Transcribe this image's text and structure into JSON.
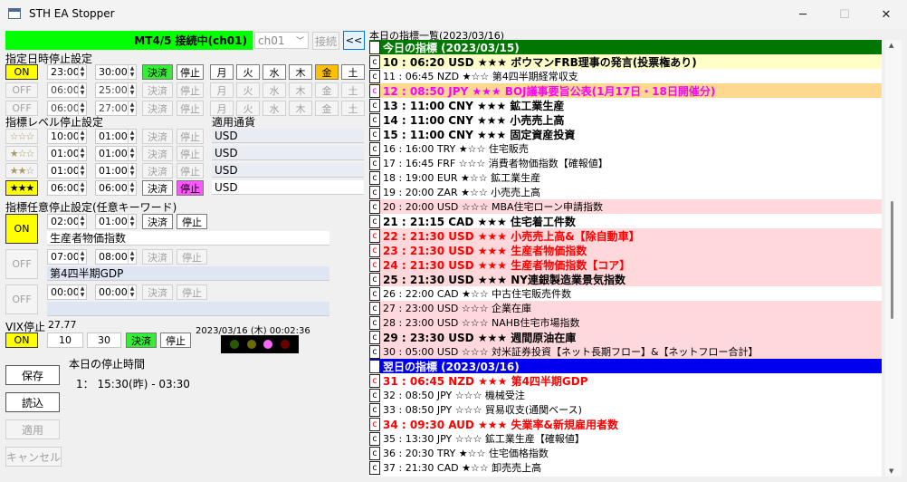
{
  "window": {
    "title": "STH EA Stopper"
  },
  "controls": {
    "minimize": "─",
    "maximize": "☐",
    "close": "✕"
  },
  "status": {
    "label": "MT4/5 接続中(ch01)",
    "channel": "ch01",
    "connect": "接続",
    "collapse": "<<",
    "color": "#00ff00"
  },
  "schedule": {
    "title": "指定日時停止設定",
    "rows": [
      {
        "toggle": "ON",
        "from": "23:00",
        "to": "30:00",
        "settle": "決済",
        "stop": "停止",
        "days": [
          "月",
          "火",
          "水",
          "木",
          "金",
          "土"
        ],
        "on": true
      },
      {
        "toggle": "OFF",
        "from": "06:00",
        "to": "25:00",
        "settle": "決済",
        "stop": "停止",
        "days": [
          "月",
          "火",
          "水",
          "木",
          "金",
          "土"
        ],
        "on": false
      },
      {
        "toggle": "OFF",
        "from": "06:00",
        "to": "27:00",
        "settle": "決済",
        "stop": "停止",
        "days": [
          "月",
          "火",
          "水",
          "木",
          "金",
          "土"
        ],
        "on": false
      }
    ]
  },
  "level": {
    "title": "指標レベル停止設定",
    "currency_title": "適用通貨",
    "rows": [
      {
        "stars": "☆☆☆",
        "from": "10:00",
        "to": "01:00",
        "settle": "決済",
        "stop": "停止",
        "currency": "USD"
      },
      {
        "stars": "★☆☆",
        "from": "01:00",
        "to": "01:00",
        "settle": "決済",
        "stop": "停止",
        "currency": "USD"
      },
      {
        "stars": "★★☆",
        "from": "01:00",
        "to": "01:00",
        "settle": "決済",
        "stop": "停止",
        "currency": "USD"
      },
      {
        "stars": "★★★",
        "from": "06:00",
        "to": "06:00",
        "settle": "決済",
        "stop": "停止",
        "currency": "USD"
      }
    ]
  },
  "keyword": {
    "title": "指標任意停止設定(任意キーワード)",
    "rows": [
      {
        "toggle": "ON",
        "from": "02:00",
        "to": "01:00",
        "settle": "決済",
        "stop": "停止",
        "keyword": "生産者物価指数"
      },
      {
        "toggle": "OFF",
        "from": "07:00",
        "to": "08:00",
        "settle": "決済",
        "stop": "停止",
        "keyword": "第4四半期GDP"
      },
      {
        "toggle": "OFF",
        "from": "00:00",
        "to": "00:00",
        "settle": "決済",
        "stop": "停止",
        "keyword": ""
      }
    ]
  },
  "vix": {
    "title": "VIX停止",
    "value": "27.77",
    "toggle": "ON",
    "threshold": "10",
    "minutes": "30",
    "settle": "決済",
    "stop": "停止"
  },
  "clock": "2023/03/16 (木) 00:02:36",
  "lights": [
    "#2a5a00",
    "#6b6b00",
    "#ff66ff",
    "#6b0000"
  ],
  "today_stop": {
    "title": "本日の停止時間",
    "entry": "1： 15:30(昨) - 03:30"
  },
  "actions": {
    "save": "保存",
    "load": "読込",
    "apply": "適用",
    "cancel": "キャンセル"
  },
  "list": {
    "title": "本日の指標一覧(2023/03/16)",
    "c": "c",
    "items": [
      {
        "text": "今日の指標 (2023/03/15)",
        "kind": "header",
        "bg": "#007700",
        "fg": "#ffffff"
      },
      {
        "text": "10 : 06:20 USD ★★★ ボウマンFRB理事の発言(投票権あり)",
        "kind": "bold",
        "bg": "#ffffc8",
        "fg": "#000000"
      },
      {
        "text": "11 : 06:45 NZD ★☆☆ 第4四半期経常収支",
        "kind": "normal",
        "bg": "#ffffff",
        "fg": "#000000"
      },
      {
        "text": "12 : 08:50 JPY ★★★ BOJ議事要旨公表(1月17日・18日開催分)",
        "kind": "bold",
        "bg": "#ffd890",
        "fg": "#ff00ff"
      },
      {
        "text": "13 : 11:00 CNY ★★★ 鉱工業生産",
        "kind": "bold",
        "bg": "#ffffff",
        "fg": "#000000"
      },
      {
        "text": "14 : 11:00 CNY ★★★ 小売売上高",
        "kind": "bold",
        "bg": "#ffffff",
        "fg": "#000000"
      },
      {
        "text": "15 : 11:00 CNY ★★★ 固定資産投資",
        "kind": "bold",
        "bg": "#ffffff",
        "fg": "#000000"
      },
      {
        "text": "16 : 16:00 TRY ★☆☆ 住宅販売",
        "kind": "normal",
        "bg": "#ffffff",
        "fg": "#000000"
      },
      {
        "text": "17 : 16:45 FRF ☆☆☆ 消費者物価指数【確報値】",
        "kind": "normal",
        "bg": "#ffffff",
        "fg": "#000000"
      },
      {
        "text": "18 : 19:00 EUR ★☆☆ 鉱工業生産",
        "kind": "normal",
        "bg": "#ffffff",
        "fg": "#000000"
      },
      {
        "text": "19 : 20:00 ZAR ★☆☆ 小売売上高",
        "kind": "normal",
        "bg": "#ffffff",
        "fg": "#000000"
      },
      {
        "text": "20 : 20:00 USD ☆☆☆ MBA住宅ローン申請指数",
        "kind": "normal",
        "bg": "#ffd8dc",
        "fg": "#000000"
      },
      {
        "text": "21 : 21:15 CAD ★★★ 住宅着工件数",
        "kind": "bold",
        "bg": "#ffffff",
        "fg": "#000000"
      },
      {
        "text": "22 : 21:30 USD ★★★ 小売売上高&【除自動車】",
        "kind": "bold",
        "bg": "#ffd8dc",
        "fg": "#ff0000"
      },
      {
        "text": "23 : 21:30 USD ★★★ 生産者物価指数",
        "kind": "bold",
        "bg": "#ffd8dc",
        "fg": "#ff0000"
      },
      {
        "text": "24 : 21:30 USD ★★★ 生産者物価指数【コア】",
        "kind": "bold",
        "bg": "#ffd8dc",
        "fg": "#ff0000"
      },
      {
        "text": "25 : 21:30 USD ★★★ NY連銀製造業景気指数",
        "kind": "bold",
        "bg": "#ffd8dc",
        "fg": "#000000"
      },
      {
        "text": "26 : 22:00 CAD ★☆☆ 中古住宅販売件数",
        "kind": "normal",
        "bg": "#ffffff",
        "fg": "#000000"
      },
      {
        "text": "27 : 23:00 USD ☆☆☆ 企業在庫",
        "kind": "normal",
        "bg": "#ffd8dc",
        "fg": "#000000"
      },
      {
        "text": "28 : 23:00 USD ☆☆☆ NAHB住宅市場指数",
        "kind": "normal",
        "bg": "#ffd8dc",
        "fg": "#000000"
      },
      {
        "text": "29 : 23:30 USD ★★★ 週間原油在庫",
        "kind": "bold",
        "bg": "#ffd8dc",
        "fg": "#000000"
      },
      {
        "text": "30 : 05:00 USD ☆☆☆ 対米証券投資【ネット長期フロー】&【ネットフロー合計】",
        "kind": "normal",
        "bg": "#ffd8dc",
        "fg": "#000000"
      },
      {
        "text": "翌日の指標 (2023/03/16)",
        "kind": "header",
        "bg": "#0000ee",
        "fg": "#ffffff"
      },
      {
        "text": "31 : 06:45 NZD ★★★ 第4四半期GDP",
        "kind": "bold",
        "bg": "#ffffff",
        "fg": "#ff0000"
      },
      {
        "text": "32 : 08:50 JPY ☆☆☆ 機械受注",
        "kind": "normal",
        "bg": "#ffffff",
        "fg": "#000000"
      },
      {
        "text": "33 : 08:50 JPY ☆☆☆ 貿易収支(通関ベース)",
        "kind": "normal",
        "bg": "#ffffff",
        "fg": "#000000"
      },
      {
        "text": "34 : 09:30 AUD ★★★ 失業率&新規雇用者数",
        "kind": "bold",
        "bg": "#ffffff",
        "fg": "#ff0000"
      },
      {
        "text": "35 : 13:30 JPY ☆☆☆ 鉱工業生産【確報値】",
        "kind": "normal",
        "bg": "#ffffff",
        "fg": "#000000"
      },
      {
        "text": "36 : 20:30 TRY ★☆☆ 住宅価格指数",
        "kind": "normal",
        "bg": "#ffffff",
        "fg": "#000000"
      },
      {
        "text": "37 : 21:30 CAD ★☆☆ 卸売売上高",
        "kind": "normal",
        "bg": "#ffffff",
        "fg": "#000000"
      }
    ]
  }
}
